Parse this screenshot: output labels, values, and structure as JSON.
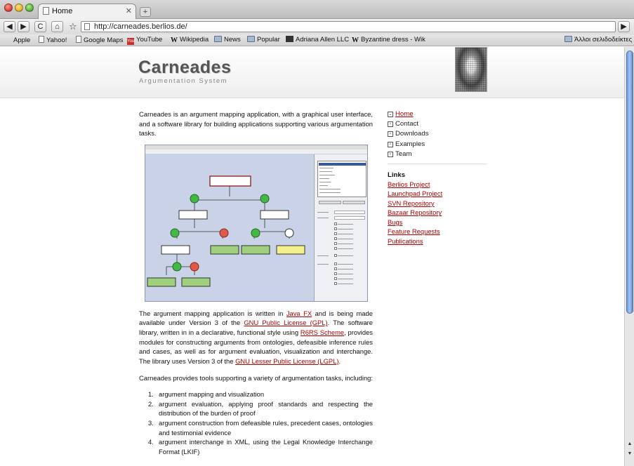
{
  "tab": {
    "title": "Home"
  },
  "toolbar": {
    "back": "◀",
    "forward": "▶",
    "reload": "C",
    "home": "⌂",
    "star": "☆",
    "go": "▶",
    "url": "http://carneades.berlios.de/"
  },
  "bookmarks": {
    "items": [
      {
        "label": "Apple",
        "icon": "apple-icon"
      },
      {
        "label": "Yahoo!",
        "icon": "page-icon"
      },
      {
        "label": "Google Maps",
        "icon": "page-icon"
      },
      {
        "label": "YouTube",
        "icon": "youtube-icon"
      },
      {
        "label": "Wikipedia",
        "icon": "wikipedia-icon"
      },
      {
        "label": "News",
        "icon": "folder-icon"
      },
      {
        "label": "Popular",
        "icon": "folder-icon"
      },
      {
        "label": "Adriana Allen LLC",
        "icon": "site-icon"
      },
      {
        "label": "Byzantine dress - Wik",
        "icon": "wikipedia-icon"
      }
    ],
    "other": "Άλλοι σελιδοδείκτες"
  },
  "header": {
    "title": "Carneades",
    "subtitle": "Argumentation System"
  },
  "main": {
    "p1": "Carneades is an argument mapping application, with a graphical user interface, and a software library for building applications supporting various argumentation tasks.",
    "p2": {
      "t1": "The argument mapping application is written in ",
      "l1": "Java FX",
      "t2": " and is being made available under Version 3 of the ",
      "l2": "GNU Public License (GPL)",
      "t3": ". The software library, written in in a declarative, functional style using ",
      "l3": "R6RS Scheme",
      "t4": ", provides modules for constructing arguments from ontologies, defeasible inference rules and cases, as well as for argument evaluation, visualization and interchange. The library uses Version 3 of the ",
      "l4": "GNU Lesser Public License (LGPL)",
      "t5": "."
    },
    "p3": "Carneades provides tools supporting a variety of argumentation tasks, including:",
    "tasks": [
      "argument mapping and visualization",
      "argument evaluation, applying proof standards and respecting the distribution of the burden of proof",
      "argument construction from defeasible rules, precedent cases, ontologies and testimonial evidence",
      "argument interchange in XML, using the Legal Knowledge Interchange Format (LKIF)"
    ]
  },
  "sidebar": {
    "nav": [
      {
        "label": "Home",
        "active": true
      },
      {
        "label": "Contact",
        "active": false
      },
      {
        "label": "Downloads",
        "active": false
      },
      {
        "label": "Examples",
        "active": false
      },
      {
        "label": "Team",
        "active": false
      }
    ],
    "links_heading": "Links",
    "links": [
      "Berlios Project",
      "Launchpad Project",
      "SVN Repository",
      "Bazaar Repository",
      "Bugs",
      "Feature Requests",
      "Publications"
    ]
  },
  "colors": {
    "link": "#b20000",
    "title": "#555555",
    "scroll_thumb": "#6f9ad8"
  }
}
